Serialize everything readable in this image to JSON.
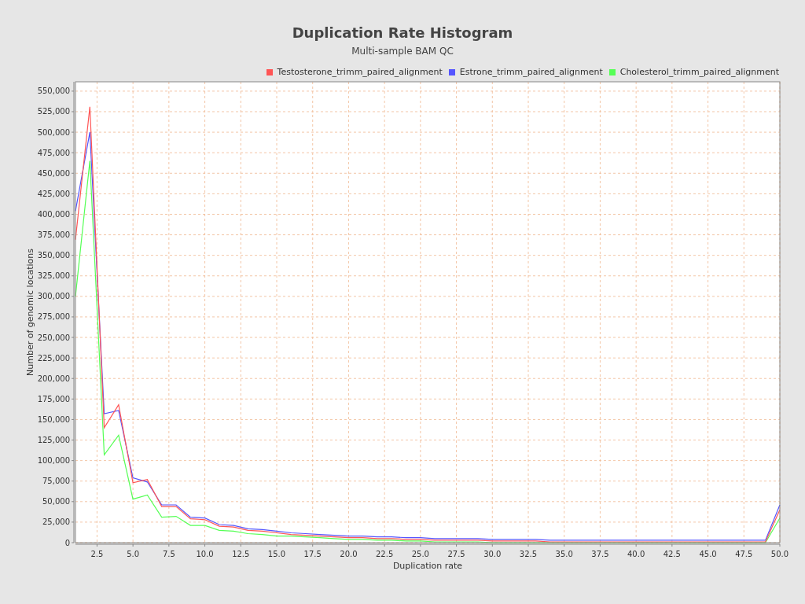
{
  "subtitle": "Multi-sample BAM QC",
  "chart_data": {
    "type": "line",
    "title": "Duplication Rate Histogram",
    "xlabel": "Duplication rate",
    "ylabel": "Number of genomic locations",
    "x": [
      1,
      2,
      3,
      4,
      5,
      6,
      7,
      8,
      9,
      10,
      11,
      12,
      13,
      14,
      15,
      16,
      17,
      18,
      19,
      20,
      21,
      22,
      23,
      24,
      25,
      26,
      27,
      28,
      29,
      30,
      31,
      32,
      33,
      34,
      35,
      36,
      37,
      38,
      39,
      40,
      41,
      42,
      43,
      44,
      45,
      46,
      47,
      48,
      49,
      50
    ],
    "series": [
      {
        "name": "Testosterone_trimm_paired_alignment",
        "color": "#ff5555",
        "values": [
          369000,
          531000,
          140000,
          168000,
          73000,
          77000,
          44000,
          44000,
          29000,
          28000,
          20000,
          19000,
          15000,
          14000,
          12000,
          10000,
          9000,
          8000,
          7000,
          6000,
          6000,
          5000,
          5000,
          4000,
          4000,
          3000,
          3000,
          3000,
          3000,
          2000,
          2000,
          2000,
          2000,
          1000,
          1000,
          1000,
          1000,
          1000,
          1000,
          1000,
          1000,
          1000,
          1000,
          1000,
          1000,
          1000,
          1000,
          1000,
          1000,
          40000
        ]
      },
      {
        "name": "Estrone_trimm_paired_alignment",
        "color": "#5555ff",
        "values": [
          404000,
          500000,
          157000,
          161000,
          79000,
          74000,
          46000,
          46000,
          31000,
          30000,
          22000,
          21000,
          17000,
          16000,
          14000,
          12000,
          11000,
          10000,
          9000,
          8000,
          8000,
          7000,
          7000,
          6000,
          6000,
          5000,
          5000,
          5000,
          5000,
          4000,
          4000,
          4000,
          4000,
          3000,
          3000,
          3000,
          3000,
          3000,
          3000,
          3000,
          3000,
          3000,
          3000,
          3000,
          3000,
          3000,
          3000,
          3000,
          3000,
          46000
        ]
      },
      {
        "name": "Cholesterol_trimm_paired_alignment",
        "color": "#55ff55",
        "values": [
          300000,
          465000,
          107000,
          131000,
          53000,
          58000,
          31000,
          32000,
          21000,
          21000,
          15000,
          14000,
          11000,
          10000,
          8000,
          8000,
          7000,
          6000,
          5000,
          4000,
          4000,
          3000,
          3000,
          2000,
          2000,
          1000,
          1000,
          1000,
          1000,
          0,
          0,
          0,
          0,
          0,
          0,
          0,
          0,
          0,
          0,
          0,
          0,
          0,
          0,
          0,
          0,
          0,
          0,
          0,
          0,
          30000
        ]
      }
    ],
    "grid": true,
    "xlim": [
      1,
      50
    ],
    "ylim": [
      0,
      561400
    ],
    "xticks": [
      {
        "value": 2.5,
        "label": "2.5"
      },
      {
        "value": 5,
        "label": "5.0"
      },
      {
        "value": 7.5,
        "label": "7.5"
      },
      {
        "value": 10,
        "label": "10.0"
      },
      {
        "value": 12.5,
        "label": "12.5"
      },
      {
        "value": 15,
        "label": "15.0"
      },
      {
        "value": 17.5,
        "label": "17.5"
      },
      {
        "value": 20,
        "label": "20.0"
      },
      {
        "value": 22.5,
        "label": "22.5"
      },
      {
        "value": 25,
        "label": "25.0"
      },
      {
        "value": 27.5,
        "label": "27.5"
      },
      {
        "value": 30,
        "label": "30.0"
      },
      {
        "value": 32.5,
        "label": "32.5"
      },
      {
        "value": 35,
        "label": "35.0"
      },
      {
        "value": 37.5,
        "label": "37.5"
      },
      {
        "value": 40,
        "label": "40.0"
      },
      {
        "value": 42.5,
        "label": "42.5"
      },
      {
        "value": 45,
        "label": "45.0"
      },
      {
        "value": 47.5,
        "label": "47.5"
      },
      {
        "value": 50,
        "label": "50.0"
      }
    ],
    "yticks": [
      {
        "value": 0,
        "label": "0"
      },
      {
        "value": 25000,
        "label": "25,000"
      },
      {
        "value": 50000,
        "label": "50,000"
      },
      {
        "value": 75000,
        "label": "75,000"
      },
      {
        "value": 100000,
        "label": "100,000"
      },
      {
        "value": 125000,
        "label": "125,000"
      },
      {
        "value": 150000,
        "label": "150,000"
      },
      {
        "value": 175000,
        "label": "175,000"
      },
      {
        "value": 200000,
        "label": "200,000"
      },
      {
        "value": 225000,
        "label": "225,000"
      },
      {
        "value": 250000,
        "label": "250,000"
      },
      {
        "value": 275000,
        "label": "275,000"
      },
      {
        "value": 300000,
        "label": "300,000"
      },
      {
        "value": 325000,
        "label": "325,000"
      },
      {
        "value": 350000,
        "label": "350,000"
      },
      {
        "value": 375000,
        "label": "375,000"
      },
      {
        "value": 400000,
        "label": "400,000"
      },
      {
        "value": 425000,
        "label": "425,000"
      },
      {
        "value": 450000,
        "label": "450,000"
      },
      {
        "value": 475000,
        "label": "475,000"
      },
      {
        "value": 500000,
        "label": "500,000"
      },
      {
        "value": 525000,
        "label": "525,000"
      },
      {
        "value": 550000,
        "label": "550,000"
      }
    ]
  }
}
